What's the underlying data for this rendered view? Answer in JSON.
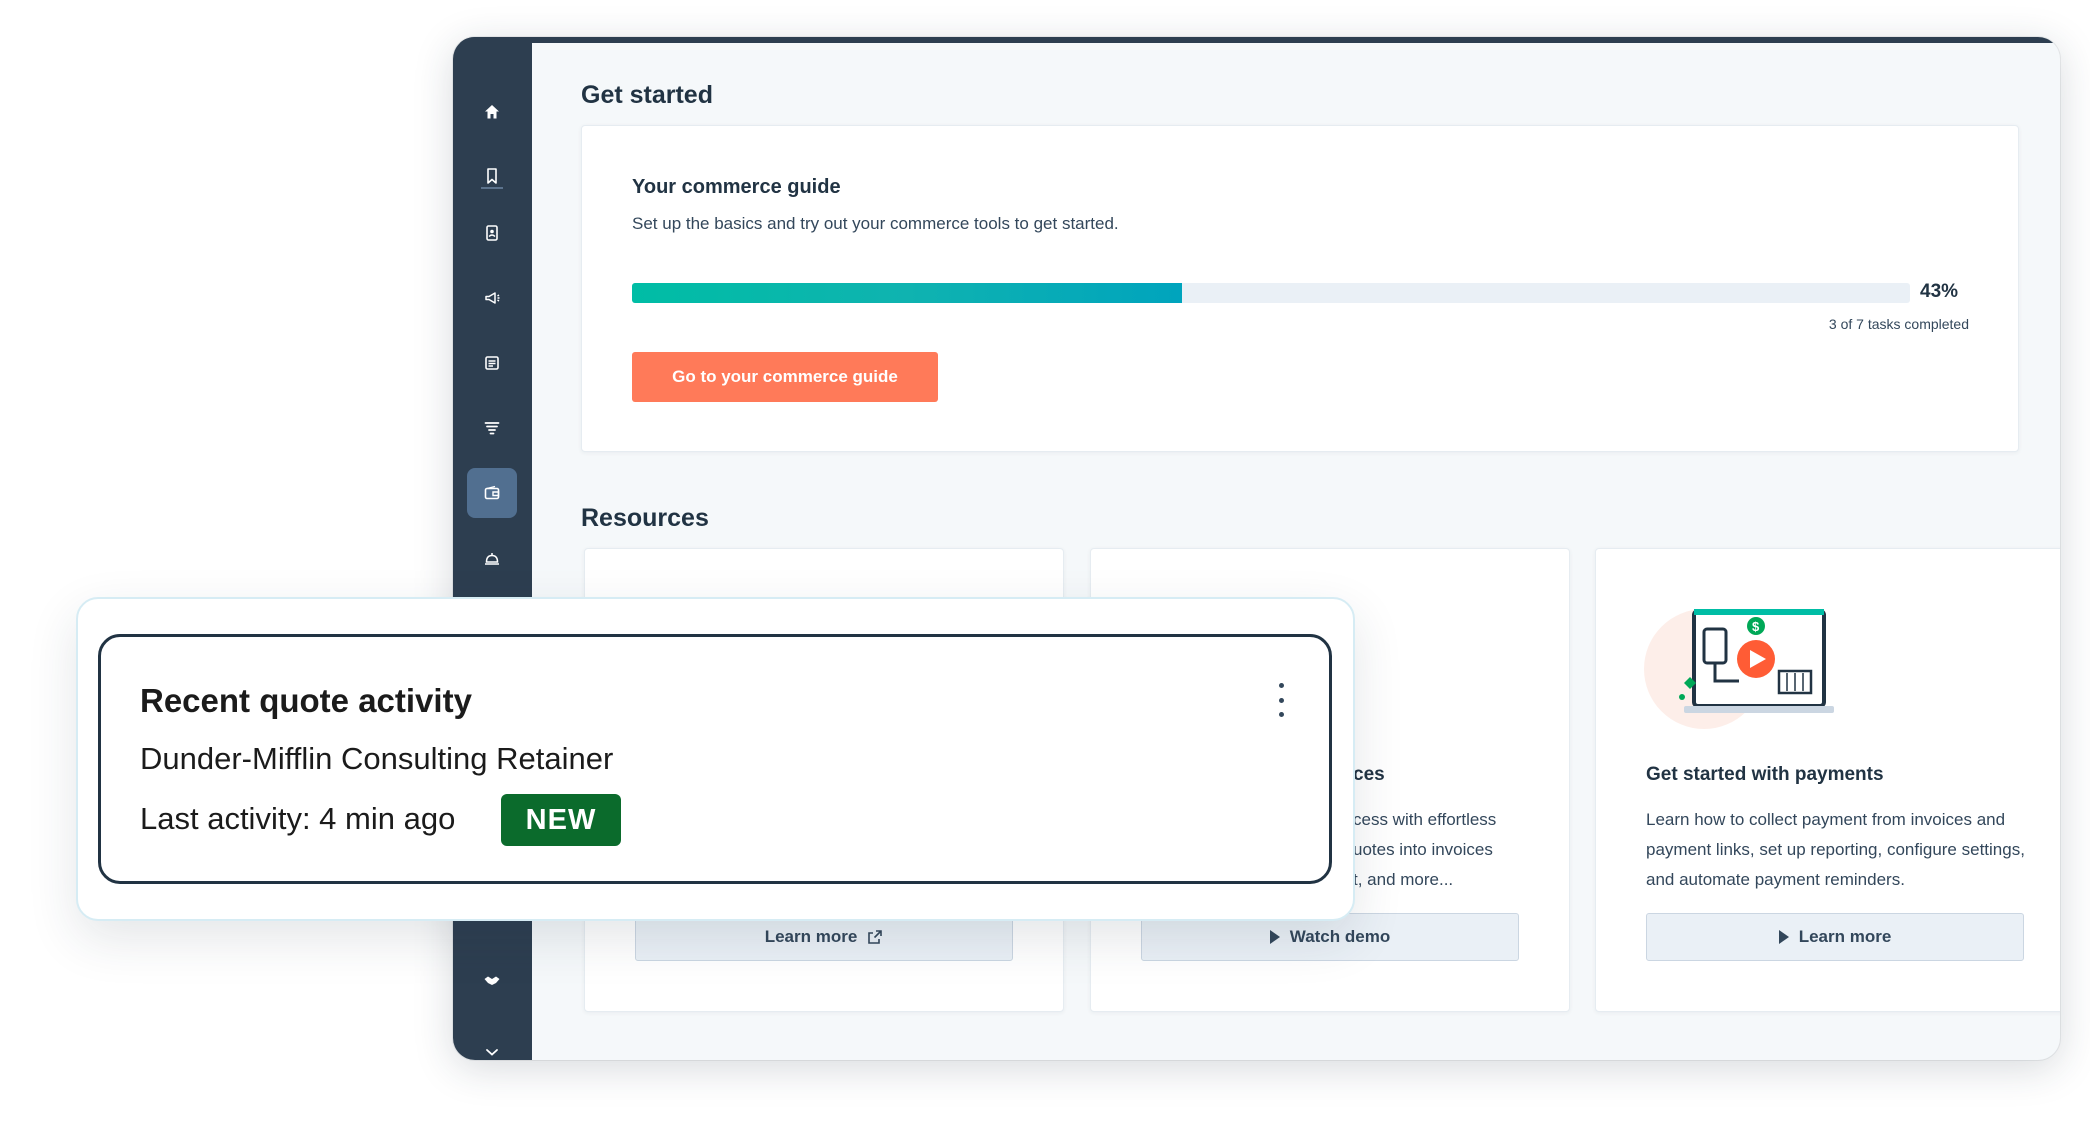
{
  "sidebar": {
    "items": [
      {
        "icon": "home-icon"
      },
      {
        "icon": "bookmark-icon"
      },
      {
        "icon": "contacts-icon"
      },
      {
        "icon": "megaphone-icon"
      },
      {
        "icon": "content-icon"
      },
      {
        "icon": "sales-funnel-icon"
      },
      {
        "icon": "commerce-wallet-icon",
        "active": true
      },
      {
        "icon": "service-bell-icon"
      },
      {
        "icon": "handshake-icon"
      },
      {
        "icon": "chevron-down-icon"
      }
    ]
  },
  "main": {
    "get_started_heading": "Get started",
    "guide": {
      "title": "Your commerce guide",
      "subtitle": "Set up the basics and try out your commerce tools to get started.",
      "progress_percent": 43,
      "progress_label": "43%",
      "tasks_label": "3 of 7 tasks completed",
      "button_label": "Go to your commerce guide"
    },
    "resources_heading": "Resources",
    "resources": [
      {
        "title": "",
        "description": "",
        "button_label": "Learn more",
        "button_icon": "external-link-icon"
      },
      {
        "title": "ces",
        "description_lines": [
          "cess with effortless",
          "uotes into invoices",
          "t, and more..."
        ],
        "button_label": "Watch demo",
        "button_icon": "play-icon"
      },
      {
        "title": "Get started with payments",
        "description": "Learn how to collect payment from invoices and payment links, set up reporting, configure settings, and automate payment reminders.",
        "button_label": "Learn more",
        "button_icon": "play-icon"
      }
    ]
  },
  "overlay": {
    "title": "Recent quote activity",
    "subtitle": "Dunder-Mifflin Consulting Retainer",
    "activity": "Last activity: 4 min ago",
    "badge": "NEW"
  },
  "colors": {
    "sidebar": "#2d3e50",
    "accent_orange": "#ff7a59",
    "progress_teal": "#00bda5",
    "badge_green": "#0b6b2c"
  }
}
